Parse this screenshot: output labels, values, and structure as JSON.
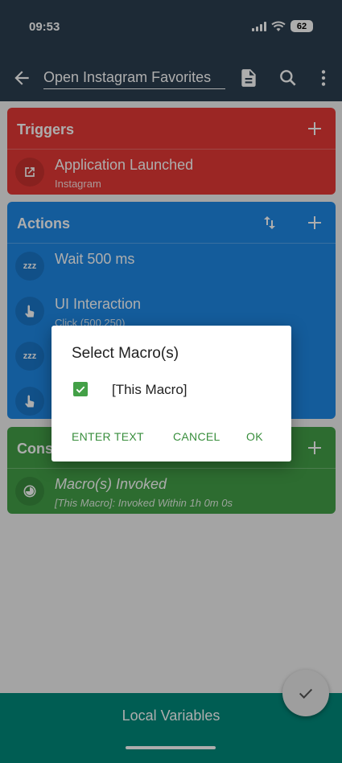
{
  "status": {
    "time": "09:53",
    "battery": "62"
  },
  "toolbar": {
    "title": "Open Instagram Favorites"
  },
  "triggers": {
    "title": "Triggers",
    "item": {
      "title": "Application Launched",
      "subtitle": "Instagram"
    }
  },
  "actions": {
    "title": "Actions",
    "items": [
      {
        "title": "Wait 500 ms",
        "subtitle": ""
      },
      {
        "title": "UI Interaction",
        "subtitle": "Click (500,250)"
      },
      {
        "title": "",
        "subtitle": ""
      },
      {
        "title": "",
        "subtitle": ""
      }
    ]
  },
  "constraints": {
    "title": "Cons",
    "item": {
      "title": "Macro(s) Invoked",
      "subtitle": "[This Macro]: Invoked Within 1h 0m 0s"
    }
  },
  "bottom_bar": {
    "label": "Local Variables"
  },
  "dialog": {
    "title": "Select Macro(s)",
    "option_label": "[This Macro]",
    "option_checked": true,
    "btn_enter_text": "ENTER TEXT",
    "btn_cancel": "CANCEL",
    "btn_ok": "OK"
  },
  "colors": {
    "appbar": "#2c3e50",
    "triggers": "#e53935",
    "actions": "#1e88e5",
    "constraints": "#43a047",
    "bottom_bar": "#00897b",
    "dialog_button": "#388e3c"
  },
  "icons": {
    "back": "arrow-left-icon",
    "document": "document-icon",
    "search": "search-icon",
    "more": "more-vert-icon",
    "add": "plus-icon",
    "sort": "swap-vertical-icon",
    "app_launch": "open-in-new-icon",
    "wait": "sleep-zzz-icon",
    "touch": "touch-hand-icon",
    "macro_invoked": "pie-icon",
    "confirm": "checkmark-icon"
  }
}
